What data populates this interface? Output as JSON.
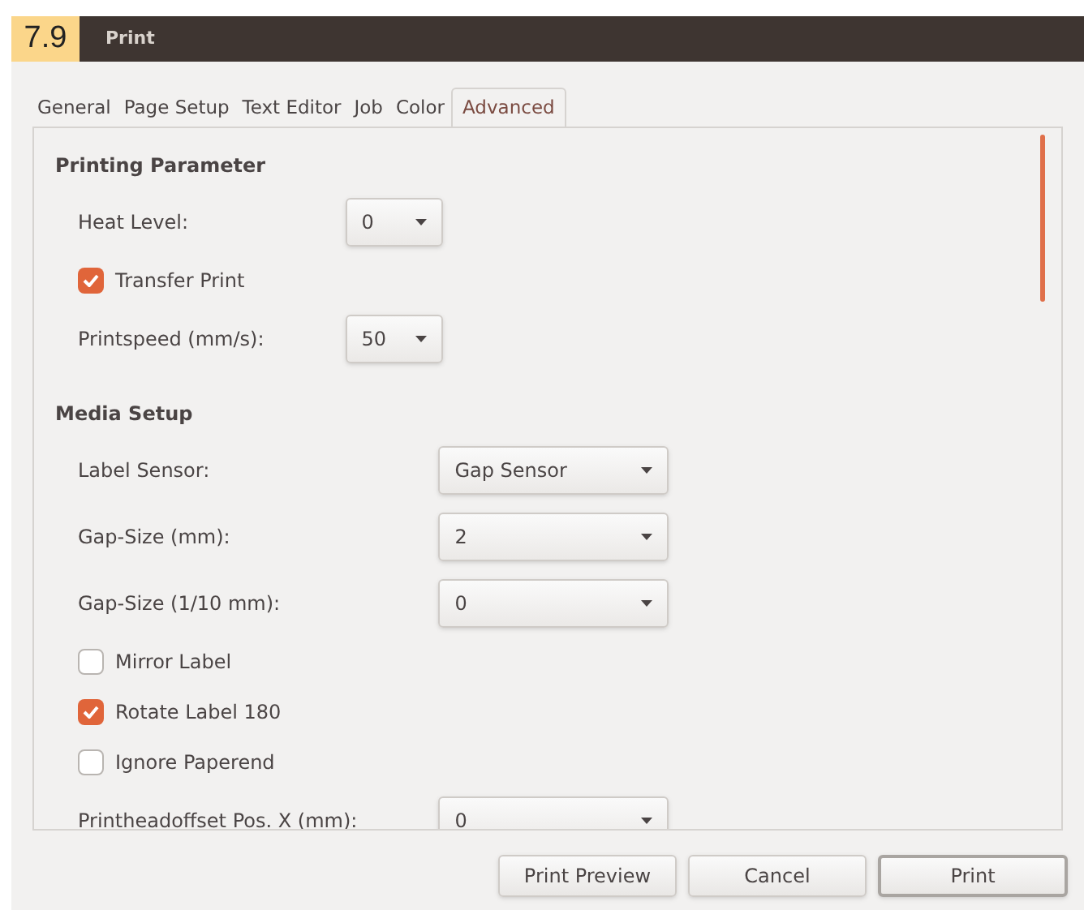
{
  "figure_label": "7.9",
  "window": {
    "title": "Print"
  },
  "tabs": [
    {
      "label": "General",
      "selected": false
    },
    {
      "label": "Page Setup",
      "selected": false
    },
    {
      "label": "Text Editor",
      "selected": false
    },
    {
      "label": "Job",
      "selected": false
    },
    {
      "label": "Color",
      "selected": false
    },
    {
      "label": "Advanced",
      "selected": true
    }
  ],
  "sections": [
    {
      "heading": "Printing Parameter",
      "kind": "compact",
      "items": [
        {
          "kind": "dropdown",
          "label": "Heat Level:",
          "value": "0"
        },
        {
          "kind": "checkbox",
          "label": "Transfer Print",
          "checked": true
        },
        {
          "kind": "dropdown",
          "label": "Printspeed (mm/s):",
          "value": "50"
        }
      ]
    },
    {
      "heading": "Media Setup",
      "kind": "wide",
      "items": [
        {
          "kind": "dropdown",
          "label": "Label Sensor:",
          "value": "Gap Sensor"
        },
        {
          "kind": "dropdown",
          "label": "Gap-Size (mm):",
          "value": "2"
        },
        {
          "kind": "dropdown",
          "label": "Gap-Size (1/10 mm):",
          "value": "0"
        },
        {
          "kind": "checkbox",
          "label": "Mirror Label",
          "checked": false
        },
        {
          "kind": "checkbox",
          "label": "Rotate Label 180",
          "checked": true
        },
        {
          "kind": "checkbox",
          "label": "Ignore Paperend",
          "checked": false
        },
        {
          "kind": "dropdown",
          "label": "Printheadoffset Pos. X (mm):",
          "value": "0"
        }
      ]
    }
  ],
  "buttons": [
    {
      "label": "Print Preview",
      "default": false
    },
    {
      "label": "Cancel",
      "default": false
    },
    {
      "label": "Print",
      "default": true
    }
  ]
}
